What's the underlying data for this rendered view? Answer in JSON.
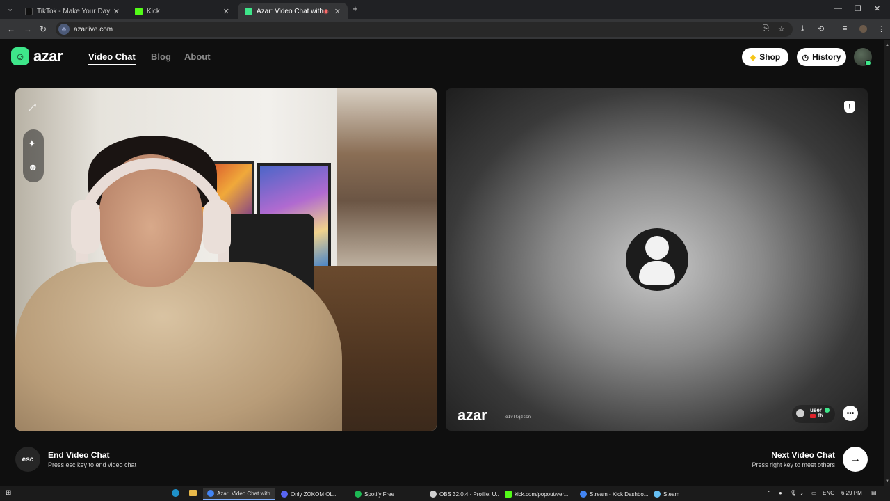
{
  "browser": {
    "tabs": [
      {
        "title": "TikTok - Make Your Day",
        "favicon_color": "#111111",
        "active": false
      },
      {
        "title": "Kick",
        "favicon_color": "#53fc18",
        "active": false
      },
      {
        "title": "Azar: Video Chat with New",
        "favicon_color": "#3ee68a",
        "active": true
      }
    ],
    "new_tab": "+",
    "close": "✕",
    "url": "azarlive.com"
  },
  "site": {
    "logo_text": "azar",
    "nav": [
      {
        "label": "Video Chat",
        "active": true
      },
      {
        "label": "Blog",
        "active": false
      },
      {
        "label": "About",
        "active": false
      }
    ],
    "shop_label": "Shop",
    "history_label": "History"
  },
  "remote": {
    "watermark": "azar",
    "watermark_id": "o1vTCqzcsn",
    "user_name": "user",
    "user_country": "TN"
  },
  "controls": {
    "esc_label": "esc",
    "end_title": "End Video Chat",
    "end_hint": "Press esc key to end video chat",
    "next_title": "Next Video Chat",
    "next_hint": "Press right key to meet others"
  },
  "taskbar": {
    "items": [
      {
        "label": "Azar: Video Chat with...",
        "color": "#4285f4",
        "active": true
      },
      {
        "label": "Only ZOKOM OL...",
        "color": "#5865f2",
        "active": false
      },
      {
        "label": "Spotify Free",
        "color": "#1db954",
        "active": false
      },
      {
        "label": "OBS 32.0.4 - Profile: U...",
        "color": "#cfcfcf",
        "active": false
      },
      {
        "label": "kick.com/popout/ver...",
        "color": "#53fc18",
        "active": false
      },
      {
        "label": "Stream - Kick Dashbo...",
        "color": "#4285f4",
        "active": false
      },
      {
        "label": "Steam",
        "color": "#66c0f4",
        "active": false
      }
    ],
    "lang": "ENG",
    "time": "6:29 PM"
  },
  "colors": {
    "accent": "#3ee68a",
    "background": "#0f0f0f"
  }
}
